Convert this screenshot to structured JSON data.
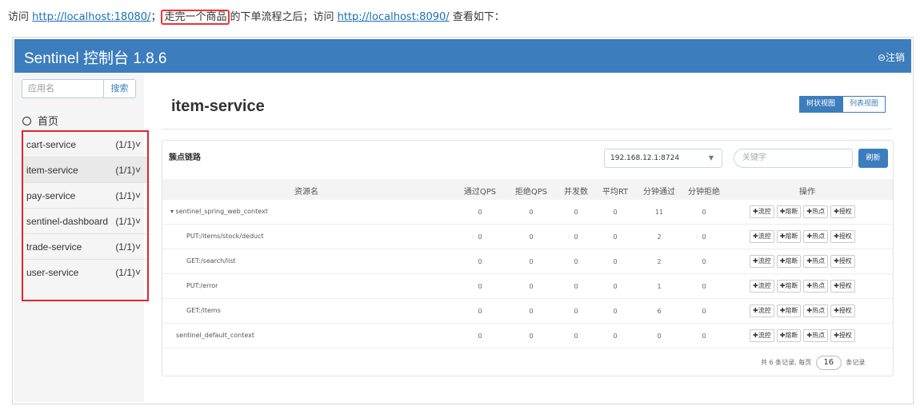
{
  "intro": {
    "prefix": "访问 ",
    "link1": "http://localhost:18080/",
    "sep": "；",
    "highlight": "走完一个商品",
    "middle": "的下单流程之后；访问 ",
    "link2": "http://localhost:8090/",
    "suffix": " 查看如下："
  },
  "topbar": {
    "title": "Sentinel 控制台 1.8.6",
    "logout": "⊖注销"
  },
  "sidebar": {
    "app_placeholder": "应用名",
    "search_label": "搜索",
    "home_label": "首页",
    "apps": [
      {
        "name": "cart-service",
        "count": "(1/1)˅"
      },
      {
        "name": "item-service",
        "count": "(1/1)˅"
      },
      {
        "name": "pay-service",
        "count": "(1/1)˅"
      },
      {
        "name": "sentinel-dashboard",
        "count": "(1/1)˅"
      },
      {
        "name": "trade-service",
        "count": "(1/1)˅"
      },
      {
        "name": "user-service",
        "count": "(1/1)˅"
      }
    ]
  },
  "main": {
    "title": "item-service",
    "view_tree": "树状视图",
    "view_list": "列表视图",
    "panel_title": "簇点链路",
    "ip_selected": "192.168.12.1:8724",
    "keyword_placeholder": "关键字",
    "refresh_label": "刷新",
    "columns": [
      "资源名",
      "通过QPS",
      "拒绝QPS",
      "并发数",
      "平均RT",
      "分钟通过",
      "分钟拒绝",
      "操作"
    ],
    "rows": [
      {
        "name": "▾ sentinel_spring_web_context",
        "v": [
          "0",
          "0",
          "0",
          "0",
          "11",
          "0"
        ]
      },
      {
        "name": "PUT:/items/stock/deduct",
        "v": [
          "0",
          "0",
          "0",
          "0",
          "2",
          "0"
        ]
      },
      {
        "name": "GET:/search/list",
        "v": [
          "0",
          "0",
          "0",
          "0",
          "2",
          "0"
        ]
      },
      {
        "name": "PUT:/error",
        "v": [
          "0",
          "0",
          "0",
          "0",
          "1",
          "0"
        ]
      },
      {
        "name": "GET:/items",
        "v": [
          "0",
          "0",
          "0",
          "0",
          "6",
          "0"
        ]
      },
      {
        "name": "sentinel_default_context",
        "v": [
          "0",
          "0",
          "0",
          "0",
          "0",
          "0"
        ]
      }
    ],
    "ops": [
      "✚流控",
      "✚熔断",
      "✚热点",
      "✚授权"
    ],
    "pager": {
      "prefix": "共 6 条记录, 每页",
      "size": "16",
      "suffix": "条记录"
    }
  },
  "colors": {
    "brand": "#3c7dbd",
    "highlight_border": "#e0262d"
  }
}
